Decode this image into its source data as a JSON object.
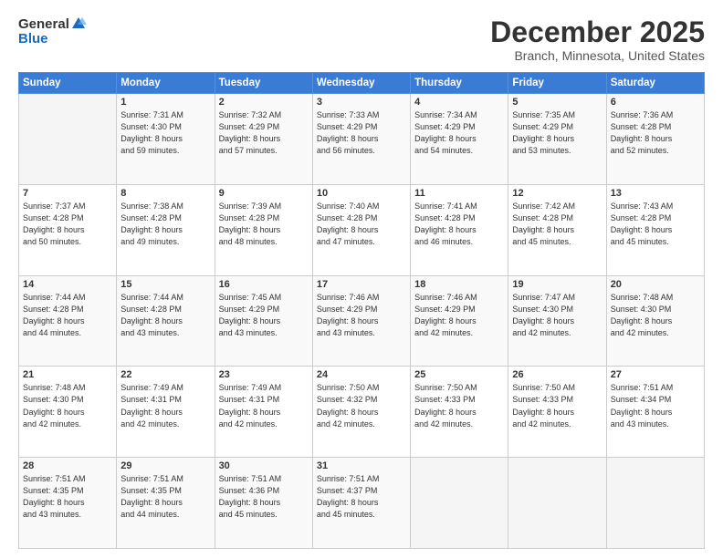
{
  "header": {
    "logo_general": "General",
    "logo_blue": "Blue",
    "title": "December 2025",
    "subtitle": "Branch, Minnesota, United States"
  },
  "calendar": {
    "days_of_week": [
      "Sunday",
      "Monday",
      "Tuesday",
      "Wednesday",
      "Thursday",
      "Friday",
      "Saturday"
    ],
    "weeks": [
      [
        {
          "day": "",
          "content": ""
        },
        {
          "day": "1",
          "content": "Sunrise: 7:31 AM\nSunset: 4:30 PM\nDaylight: 8 hours\nand 59 minutes."
        },
        {
          "day": "2",
          "content": "Sunrise: 7:32 AM\nSunset: 4:29 PM\nDaylight: 8 hours\nand 57 minutes."
        },
        {
          "day": "3",
          "content": "Sunrise: 7:33 AM\nSunset: 4:29 PM\nDaylight: 8 hours\nand 56 minutes."
        },
        {
          "day": "4",
          "content": "Sunrise: 7:34 AM\nSunset: 4:29 PM\nDaylight: 8 hours\nand 54 minutes."
        },
        {
          "day": "5",
          "content": "Sunrise: 7:35 AM\nSunset: 4:29 PM\nDaylight: 8 hours\nand 53 minutes."
        },
        {
          "day": "6",
          "content": "Sunrise: 7:36 AM\nSunset: 4:28 PM\nDaylight: 8 hours\nand 52 minutes."
        }
      ],
      [
        {
          "day": "7",
          "content": "Sunrise: 7:37 AM\nSunset: 4:28 PM\nDaylight: 8 hours\nand 50 minutes."
        },
        {
          "day": "8",
          "content": "Sunrise: 7:38 AM\nSunset: 4:28 PM\nDaylight: 8 hours\nand 49 minutes."
        },
        {
          "day": "9",
          "content": "Sunrise: 7:39 AM\nSunset: 4:28 PM\nDaylight: 8 hours\nand 48 minutes."
        },
        {
          "day": "10",
          "content": "Sunrise: 7:40 AM\nSunset: 4:28 PM\nDaylight: 8 hours\nand 47 minutes."
        },
        {
          "day": "11",
          "content": "Sunrise: 7:41 AM\nSunset: 4:28 PM\nDaylight: 8 hours\nand 46 minutes."
        },
        {
          "day": "12",
          "content": "Sunrise: 7:42 AM\nSunset: 4:28 PM\nDaylight: 8 hours\nand 45 minutes."
        },
        {
          "day": "13",
          "content": "Sunrise: 7:43 AM\nSunset: 4:28 PM\nDaylight: 8 hours\nand 45 minutes."
        }
      ],
      [
        {
          "day": "14",
          "content": "Sunrise: 7:44 AM\nSunset: 4:28 PM\nDaylight: 8 hours\nand 44 minutes."
        },
        {
          "day": "15",
          "content": "Sunrise: 7:44 AM\nSunset: 4:28 PM\nDaylight: 8 hours\nand 43 minutes."
        },
        {
          "day": "16",
          "content": "Sunrise: 7:45 AM\nSunset: 4:29 PM\nDaylight: 8 hours\nand 43 minutes."
        },
        {
          "day": "17",
          "content": "Sunrise: 7:46 AM\nSunset: 4:29 PM\nDaylight: 8 hours\nand 43 minutes."
        },
        {
          "day": "18",
          "content": "Sunrise: 7:46 AM\nSunset: 4:29 PM\nDaylight: 8 hours\nand 42 minutes."
        },
        {
          "day": "19",
          "content": "Sunrise: 7:47 AM\nSunset: 4:30 PM\nDaylight: 8 hours\nand 42 minutes."
        },
        {
          "day": "20",
          "content": "Sunrise: 7:48 AM\nSunset: 4:30 PM\nDaylight: 8 hours\nand 42 minutes."
        }
      ],
      [
        {
          "day": "21",
          "content": "Sunrise: 7:48 AM\nSunset: 4:30 PM\nDaylight: 8 hours\nand 42 minutes."
        },
        {
          "day": "22",
          "content": "Sunrise: 7:49 AM\nSunset: 4:31 PM\nDaylight: 8 hours\nand 42 minutes."
        },
        {
          "day": "23",
          "content": "Sunrise: 7:49 AM\nSunset: 4:31 PM\nDaylight: 8 hours\nand 42 minutes."
        },
        {
          "day": "24",
          "content": "Sunrise: 7:50 AM\nSunset: 4:32 PM\nDaylight: 8 hours\nand 42 minutes."
        },
        {
          "day": "25",
          "content": "Sunrise: 7:50 AM\nSunset: 4:33 PM\nDaylight: 8 hours\nand 42 minutes."
        },
        {
          "day": "26",
          "content": "Sunrise: 7:50 AM\nSunset: 4:33 PM\nDaylight: 8 hours\nand 42 minutes."
        },
        {
          "day": "27",
          "content": "Sunrise: 7:51 AM\nSunset: 4:34 PM\nDaylight: 8 hours\nand 43 minutes."
        }
      ],
      [
        {
          "day": "28",
          "content": "Sunrise: 7:51 AM\nSunset: 4:35 PM\nDaylight: 8 hours\nand 43 minutes."
        },
        {
          "day": "29",
          "content": "Sunrise: 7:51 AM\nSunset: 4:35 PM\nDaylight: 8 hours\nand 44 minutes."
        },
        {
          "day": "30",
          "content": "Sunrise: 7:51 AM\nSunset: 4:36 PM\nDaylight: 8 hours\nand 45 minutes."
        },
        {
          "day": "31",
          "content": "Sunrise: 7:51 AM\nSunset: 4:37 PM\nDaylight: 8 hours\nand 45 minutes."
        },
        {
          "day": "",
          "content": ""
        },
        {
          "day": "",
          "content": ""
        },
        {
          "day": "",
          "content": ""
        }
      ]
    ]
  }
}
